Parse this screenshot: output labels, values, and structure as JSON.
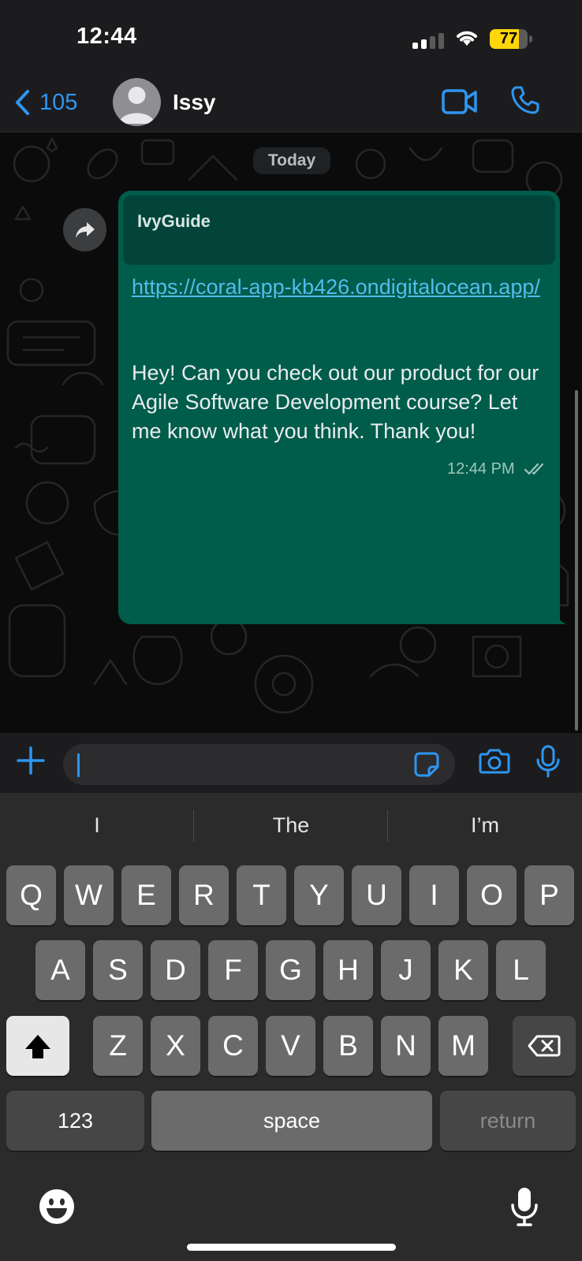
{
  "status_bar": {
    "time": "12:44",
    "battery_level": "77",
    "battery_fraction": 0.77,
    "battery_color": "#ffd60a"
  },
  "header": {
    "back_count": "105",
    "contact_name": "Issy",
    "accent_color": "#2e96f0",
    "icons": [
      "chevron-left-icon",
      "avatar",
      "video-call-icon",
      "phone-icon"
    ]
  },
  "chat": {
    "date_label": "Today",
    "message": {
      "preview_title": "IvyGuide",
      "link": "https://coral-app-kb426.ondigitalocean.app/",
      "text": "Hey! Can you check out our product for our Agile Software Development course? Let me know what you think. Thank you!",
      "time": "12:44 PM",
      "status": "read",
      "bubble_color": "#005c4b"
    }
  },
  "input_bar": {
    "value": "",
    "icons": [
      "plus-icon",
      "sticker-icon",
      "camera-icon",
      "microphone-icon"
    ]
  },
  "keyboard": {
    "suggestions": [
      "I",
      "The",
      "I’m"
    ],
    "row1": [
      "Q",
      "W",
      "E",
      "R",
      "T",
      "Y",
      "U",
      "I",
      "O",
      "P"
    ],
    "row2": [
      "A",
      "S",
      "D",
      "F",
      "G",
      "H",
      "J",
      "K",
      "L"
    ],
    "row3": [
      "Z",
      "X",
      "C",
      "V",
      "B",
      "N",
      "M"
    ],
    "numbers_label": "123",
    "space_label": "space",
    "return_label": "return"
  }
}
